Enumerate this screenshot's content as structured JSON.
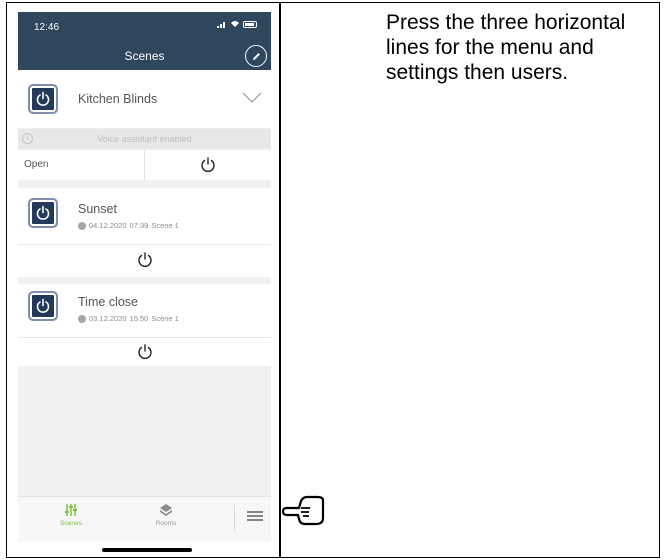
{
  "status": {
    "time": "12:46"
  },
  "header": {
    "title": "Scenes"
  },
  "kitchen": {
    "name": "Kitchen Blinds",
    "voice": "Voice assistant enabled",
    "open_label": "Open"
  },
  "scenes": [
    {
      "name": "Sunset",
      "date": "04.12.2020",
      "time": "07:39",
      "label": "Scene 1"
    },
    {
      "name": "Time close",
      "date": "03.12.2020",
      "time": "15:50",
      "label": "Scene 1"
    }
  ],
  "nav": {
    "scenes": "Scenes",
    "rooms": "Rooms"
  },
  "instruction": "Press the three horizontal lines for the menu and settings then users.",
  "colors": {
    "header": "#2e475d",
    "accent": "#7ac143",
    "scene_icon": "#24395a"
  },
  "icons": [
    "pencil-icon",
    "power-icon",
    "chevron-down-icon",
    "clock-icon",
    "sliders-icon",
    "rooms-icon",
    "hamburger-menu-icon",
    "pointing-hand-icon"
  ]
}
